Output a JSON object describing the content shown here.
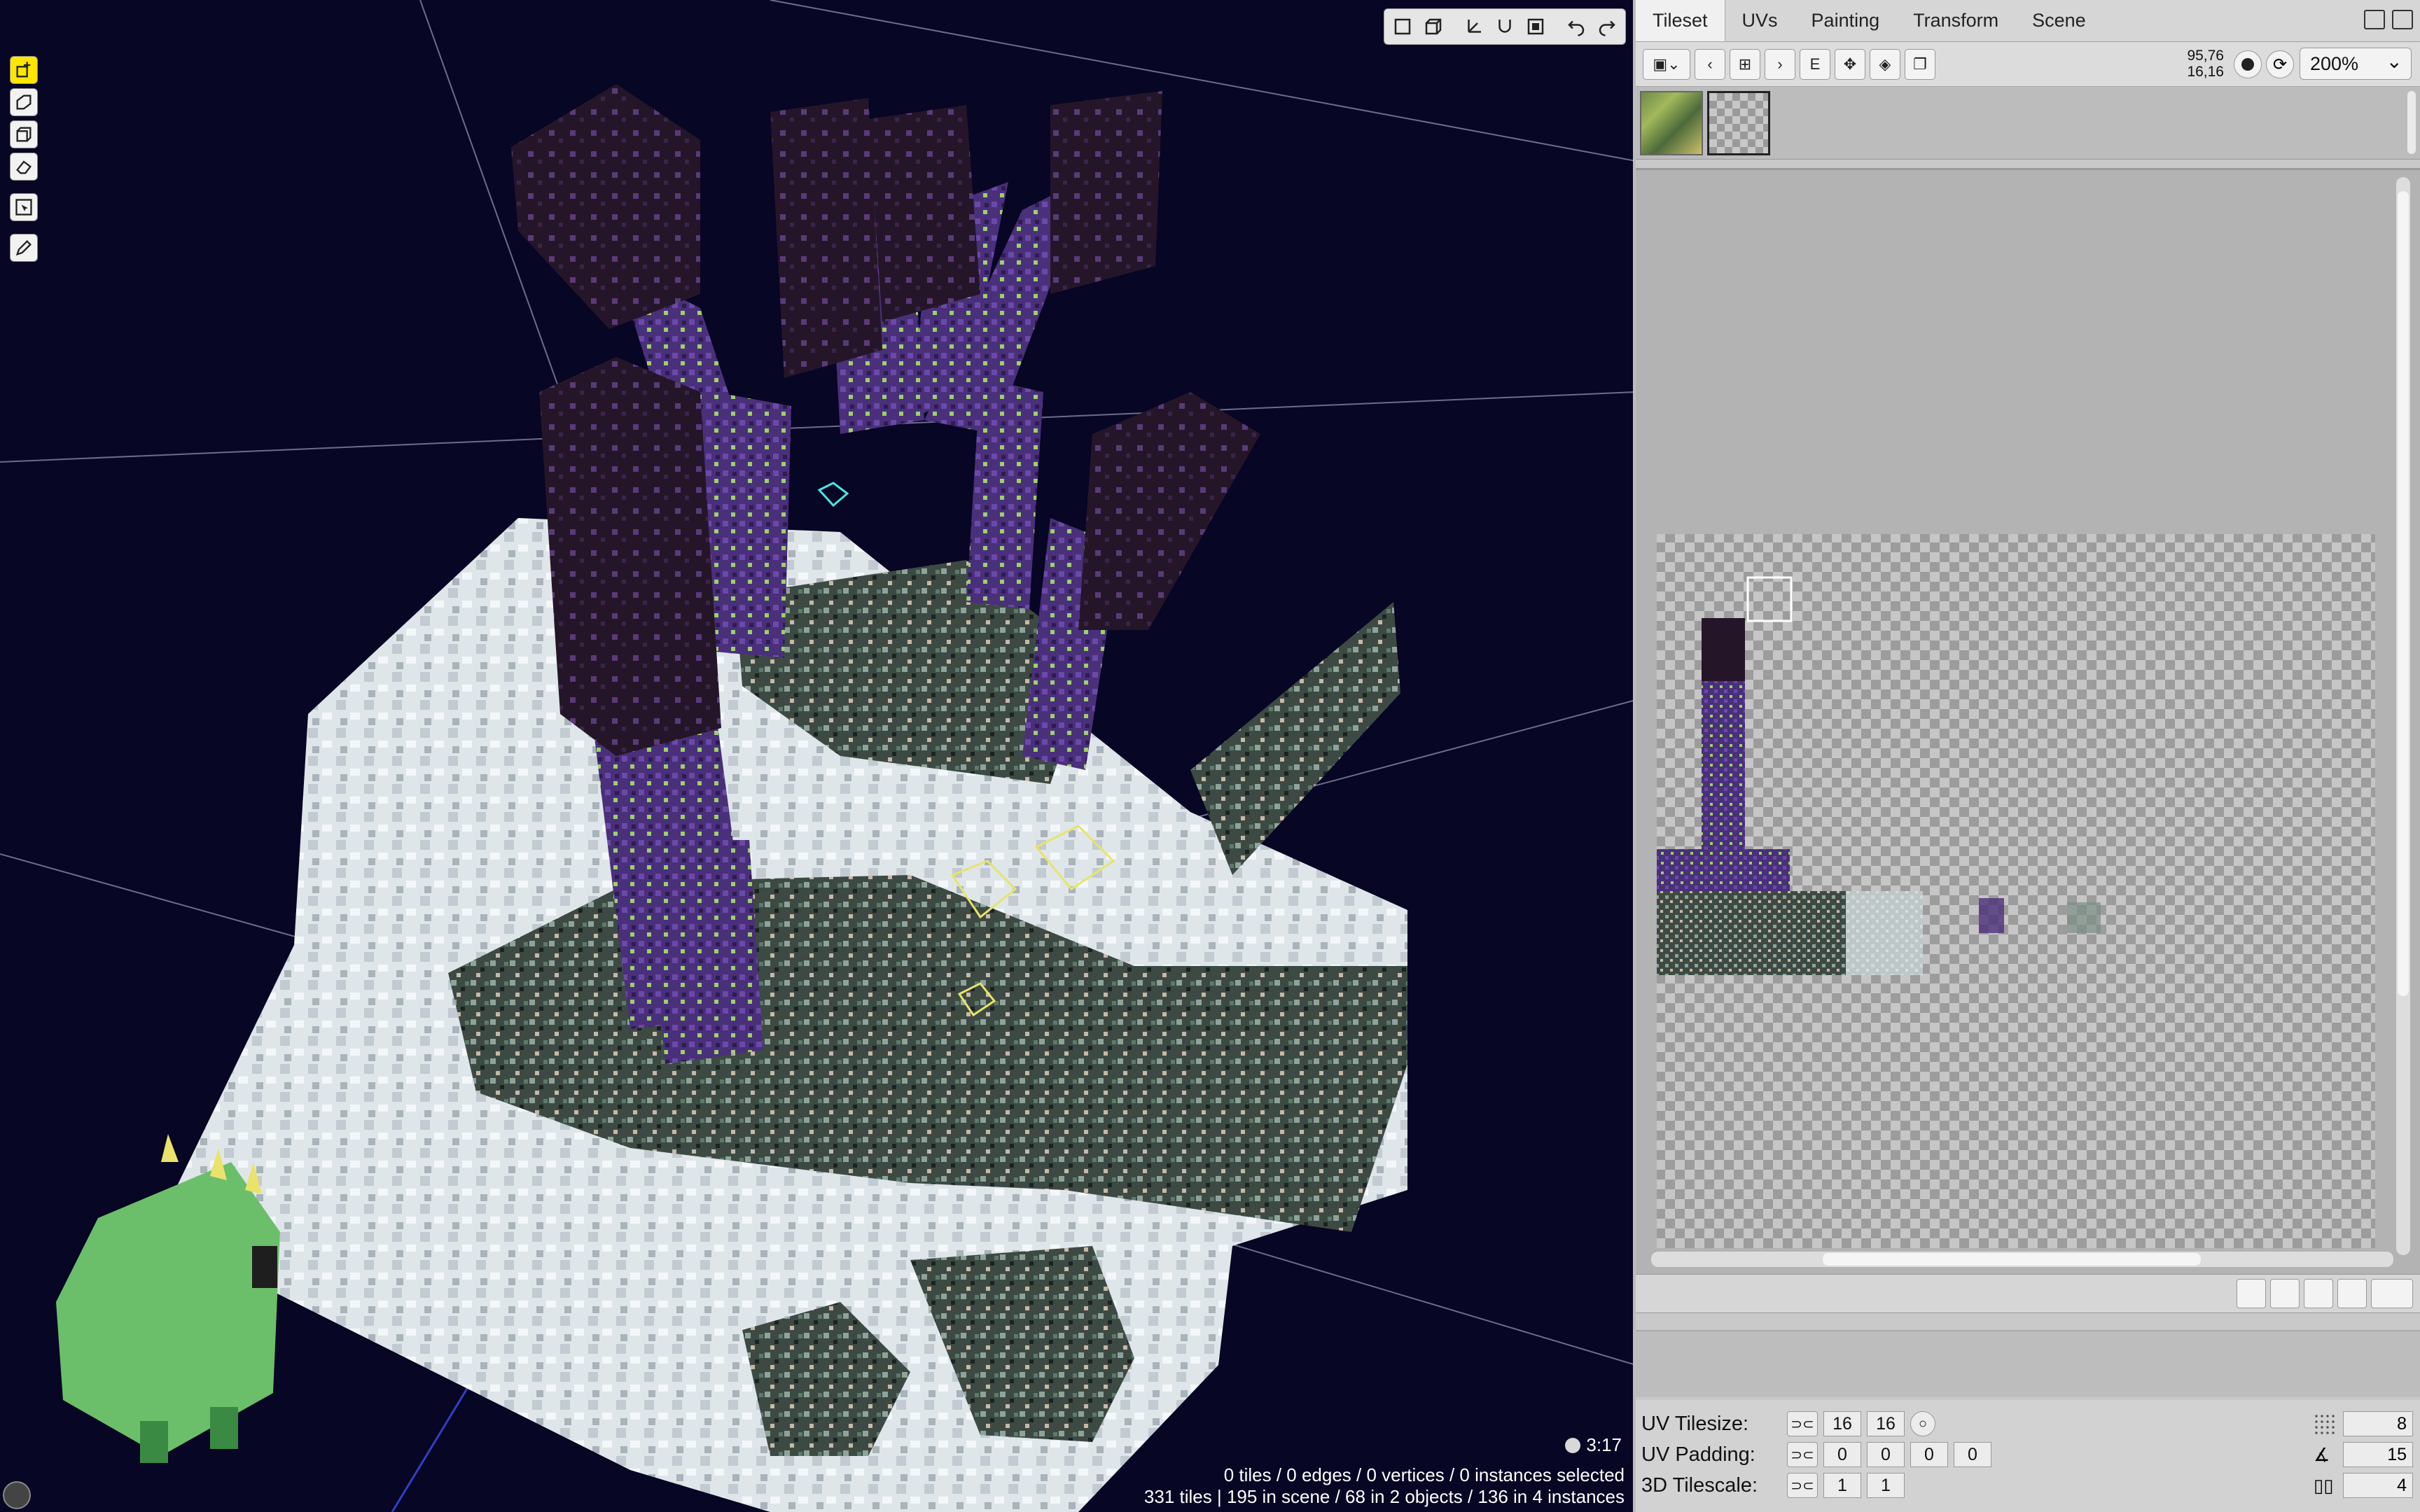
{
  "viewport": {
    "clock": "3:17",
    "selection_status": "0 tiles / 0 edges / 0 vertices / 0 instances selected",
    "scene_status": "331 tiles | 195 in scene / 68 in 2 objects / 136 in 4 instances"
  },
  "panel": {
    "tabs": [
      {
        "label": "Tileset"
      },
      {
        "label": "UVs"
      },
      {
        "label": "Painting"
      },
      {
        "label": "Transform"
      },
      {
        "label": "Scene"
      }
    ],
    "coords_top": "95,76",
    "coords_bottom": "16,16",
    "zoom": "200%",
    "toolbar_letter": "E",
    "props": {
      "uv_tilesize_label": "UV Tilesize:",
      "uv_tilesize": [
        "16",
        "16"
      ],
      "uv_padding_label": "UV Padding:",
      "uv_padding": [
        "0",
        "0",
        "0",
        "0"
      ],
      "tilescale_label": "3D Tilescale:",
      "tilescale": [
        "1",
        "1"
      ],
      "grid_value": "8",
      "angle_value": "15",
      "book_value": "4"
    }
  },
  "colors": {
    "viewport_bg": "#070624",
    "snow": "#dfe6ea",
    "crystal_purple": "#4a2f7a",
    "obsidian": "#2a1a36",
    "moss": "#3d4a44",
    "frog_green": "#6bbf6a",
    "active_tool": "#ffe600"
  }
}
